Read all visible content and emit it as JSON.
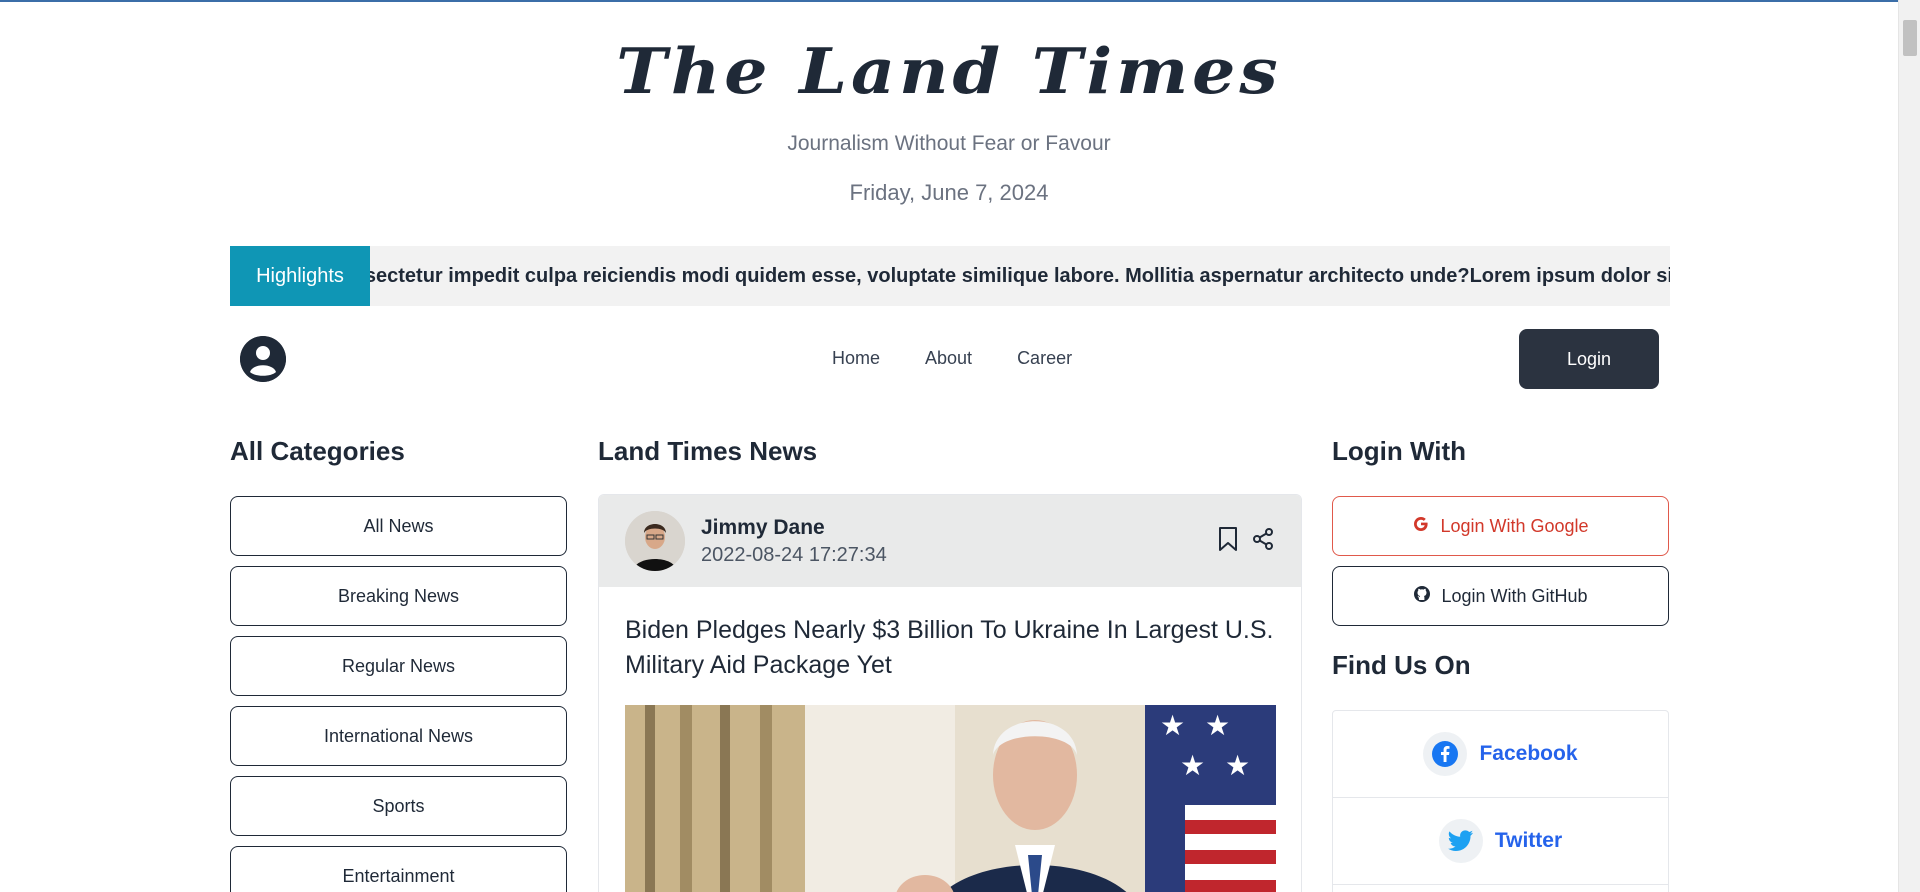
{
  "header": {
    "logo": "The Land Times",
    "tagline": "Journalism Without Fear or Favour",
    "date": "Friday, June 7, 2024"
  },
  "highlights": {
    "button_label": "Highlights",
    "ticker_text": "Consectetur impedit culpa reiciendis modi quidem esse, voluptate similique labore. Mollitia aspernatur architecto unde?Lorem ipsum dolor sit amet"
  },
  "nav": {
    "items": [
      "Home",
      "About",
      "Career"
    ],
    "login_label": "Login"
  },
  "left": {
    "title": "All Categories",
    "categories": [
      "All News",
      "Breaking News",
      "Regular News",
      "International News",
      "Sports",
      "Entertainment"
    ]
  },
  "center": {
    "title": "Land Times News",
    "card": {
      "author": "Jimmy Dane",
      "published": "2022-08-24 17:27:34",
      "headline": "Biden Pledges Nearly $3 Billion To Ukraine In Largest U.S. Military Aid Package Yet"
    }
  },
  "right": {
    "login_title": "Login With",
    "google_label": "Login With Google",
    "github_label": "Login With GitHub",
    "find_title": "Find Us On",
    "find_items": [
      "Facebook",
      "Twitter"
    ]
  },
  "colors": {
    "accent": "#0f96b5",
    "dark": "#2b3340",
    "google": "#d2382a",
    "link": "#2563eb"
  }
}
